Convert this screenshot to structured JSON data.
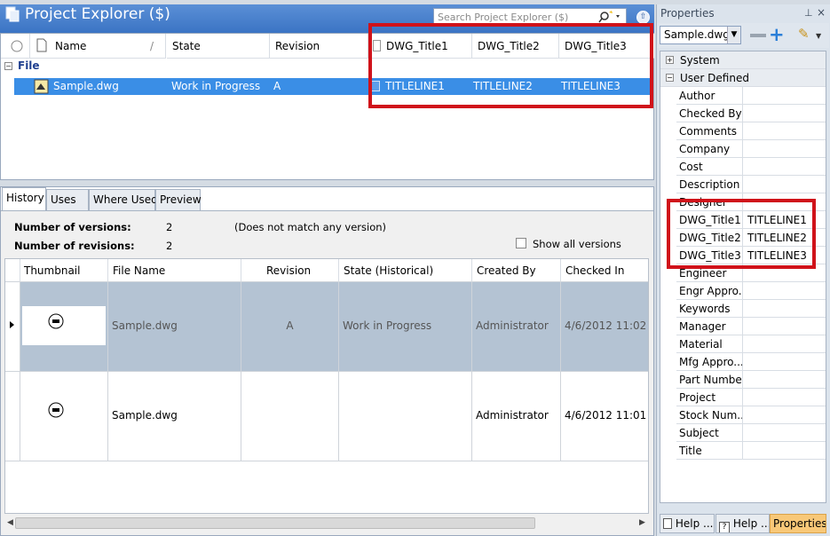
{
  "explorer": {
    "title": "Project Explorer ($)",
    "search_placeholder": "Search Project Explorer ($)",
    "columns": [
      "Name",
      "State",
      "Revision",
      "DWG_Title1",
      "DWG_Title2",
      "DWG_Title3"
    ],
    "group_label": "File",
    "row": {
      "name": "Sample.dwg",
      "state": "Work in Progress",
      "revision": "A",
      "t1": "TITLELINE1",
      "t2": "TITLELINE2",
      "t3": "TITLELINE3"
    }
  },
  "tabs": [
    "History",
    "Uses",
    "Where Used",
    "Preview"
  ],
  "history": {
    "versions_label": "Number of versions:",
    "versions_value": "2",
    "revisions_label": "Number of revisions:",
    "revisions_value": "2",
    "match_note": "(Does not match any version)",
    "show_all_label": "Show all versions",
    "columns": [
      "Thumbnail",
      "File Name",
      "Revision",
      "State (Historical)",
      "Created By",
      "Checked In"
    ],
    "rows": [
      {
        "file": "Sample.dwg",
        "revision": "A",
        "state": "Work in Progress",
        "created_by": "Administrator",
        "checked_in": "4/6/2012 11:02 ..."
      },
      {
        "file": "Sample.dwg",
        "revision": "",
        "state": "",
        "created_by": "Administrator",
        "checked_in": "4/6/2012 11:01 ..."
      }
    ]
  },
  "properties": {
    "title": "Properties",
    "file_combo": "Sample.dwg",
    "groups": [
      "System",
      "User Defined"
    ],
    "items": [
      {
        "name": "Author",
        "value": ""
      },
      {
        "name": "Checked By",
        "value": ""
      },
      {
        "name": "Comments",
        "value": ""
      },
      {
        "name": "Company",
        "value": ""
      },
      {
        "name": "Cost",
        "value": ""
      },
      {
        "name": "Description",
        "value": ""
      },
      {
        "name": "Designer",
        "value": ""
      },
      {
        "name": "DWG_Title1",
        "value": "TITLELINE1"
      },
      {
        "name": "DWG_Title2",
        "value": "TITLELINE2"
      },
      {
        "name": "DWG_Title3",
        "value": "TITLELINE3"
      },
      {
        "name": "Engineer",
        "value": ""
      },
      {
        "name": "Engr Appro...",
        "value": ""
      },
      {
        "name": "Keywords",
        "value": ""
      },
      {
        "name": "Manager",
        "value": ""
      },
      {
        "name": "Material",
        "value": ""
      },
      {
        "name": "Mfg Appro...",
        "value": ""
      },
      {
        "name": "Part Number",
        "value": ""
      },
      {
        "name": "Project",
        "value": ""
      },
      {
        "name": "Stock Num...",
        "value": ""
      },
      {
        "name": "Subject",
        "value": ""
      },
      {
        "name": "Title",
        "value": ""
      }
    ],
    "bottom_tabs": [
      "Help ...",
      "Help ...",
      "Properties"
    ]
  },
  "colors": {
    "accent": "#3b74c4",
    "selection": "#3a8ee6",
    "highlight": "#d0121a",
    "hist_selected": "#b4c3d3"
  }
}
